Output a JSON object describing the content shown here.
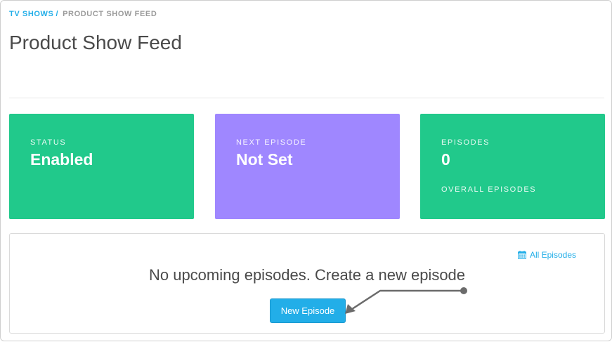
{
  "breadcrumb": {
    "parent": "TV SHOWS",
    "separator": "/",
    "current": "PRODUCT SHOW FEED"
  },
  "page_title": "Product Show Feed",
  "cards": {
    "status": {
      "label": "STATUS",
      "value": "Enabled",
      "color": "#21c98b"
    },
    "next_episode": {
      "label": "NEXT EPISODE",
      "value": "Not Set",
      "color": "#9f87ff"
    },
    "episodes": {
      "label": "EPISODES",
      "value": "0",
      "sub": "OVERALL EPISODES",
      "color": "#21c98b"
    }
  },
  "panel": {
    "all_episodes_link": "All Episodes",
    "all_episodes_icon": "calendar-icon",
    "empty_message": "No upcoming episodes. Create a new episode",
    "new_episode_button": "New Episode"
  },
  "colors": {
    "accent": "#22aee8",
    "annotation_arrow": "#6b6b6b"
  }
}
